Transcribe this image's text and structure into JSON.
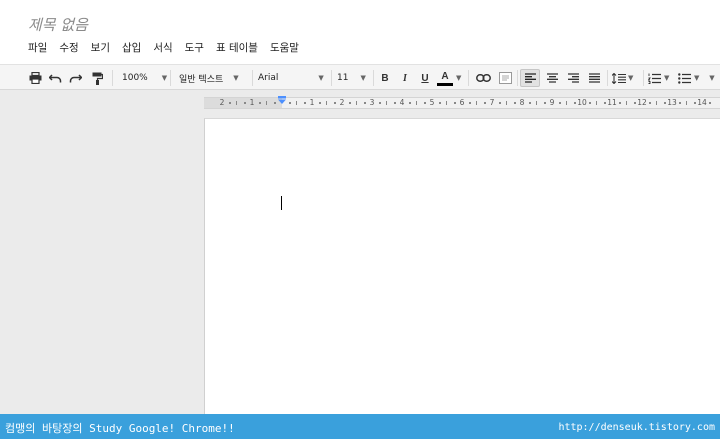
{
  "document": {
    "title": "제목 없음"
  },
  "menu": [
    "파일",
    "수정",
    "보기",
    "삽입",
    "서식",
    "도구",
    "표",
    "테이블",
    "도움말"
  ],
  "toolbar": {
    "zoom": "100%",
    "style": "일반 텍스트",
    "font": "Arial",
    "font_size": "11",
    "bold": "B",
    "italic": "I",
    "underline": "U",
    "text_color": "A",
    "text_color_swatch": "#000000"
  },
  "ruler": {
    "labels": [
      "2",
      "1",
      "1",
      "2",
      "3",
      "4",
      "5",
      "6",
      "7",
      "8",
      "9",
      "10",
      "11",
      "12",
      "13",
      "14"
    ]
  },
  "footer": {
    "left": "컴맹의 바탕장의 Study Google! Chrome!!",
    "right": "http://denseuk.tistory.com"
  },
  "colors": {
    "footer_bg": "#3aa0dc",
    "active_align_bg": "#e2e2e2"
  }
}
